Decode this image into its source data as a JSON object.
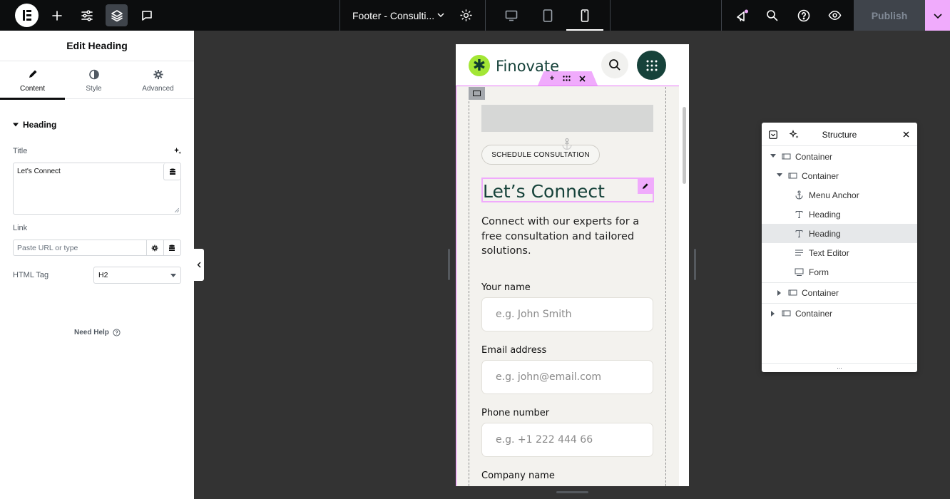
{
  "topbar": {
    "document_title": "Footer - Consulti...",
    "publish_label": "Publish"
  },
  "panel": {
    "title": "Edit Heading",
    "tabs": [
      {
        "label": "Content",
        "icon": "pencil-icon"
      },
      {
        "label": "Style",
        "icon": "contrast-icon"
      },
      {
        "label": "Advanced",
        "icon": "gear-icon"
      }
    ],
    "section_heading": "Heading",
    "title_label": "Title",
    "title_value": "Let's Connect",
    "link_label": "Link",
    "link_placeholder": "Paste URL or type",
    "html_tag_label": "HTML Tag",
    "html_tag_value": "H2",
    "help_label": "Need Help"
  },
  "preview": {
    "brand_name": "Finovate",
    "brand_mark": "✱",
    "button_label": "SCHEDULE CONSULTATION",
    "heading": "Let’s Connect",
    "description": "Connect with our experts for a free consultation and tailored solutions.",
    "form": {
      "name_label": "Your name",
      "name_placeholder": "e.g. John Smith",
      "email_label": "Email address",
      "email_placeholder": "e.g. john@email.com",
      "phone_label": "Phone number",
      "phone_placeholder": "e.g. +1 222 444 66",
      "company_label": "Company name"
    }
  },
  "navigator": {
    "title": "Structure",
    "items": [
      {
        "label": "Container",
        "icon": "container-icon",
        "expanded": true
      },
      {
        "label": "Container",
        "icon": "container-icon",
        "expanded": true
      },
      {
        "label": "Menu Anchor",
        "icon": "anchor-icon"
      },
      {
        "label": "Heading",
        "icon": "heading-icon"
      },
      {
        "label": "Heading",
        "icon": "heading-icon",
        "selected": true
      },
      {
        "label": "Text Editor",
        "icon": "text-editor-icon"
      },
      {
        "label": "Form",
        "icon": "form-icon"
      },
      {
        "label": "Container",
        "icon": "container-icon",
        "expanded": false
      },
      {
        "label": "Container",
        "icon": "container-icon",
        "expanded": false
      }
    ],
    "footer": "..."
  },
  "colors": {
    "accent": "#f0abfc",
    "brand_dark": "#16423a",
    "brand_lime": "#a3e635",
    "topbar": "#0c0d0e",
    "canvas": "#333333"
  }
}
